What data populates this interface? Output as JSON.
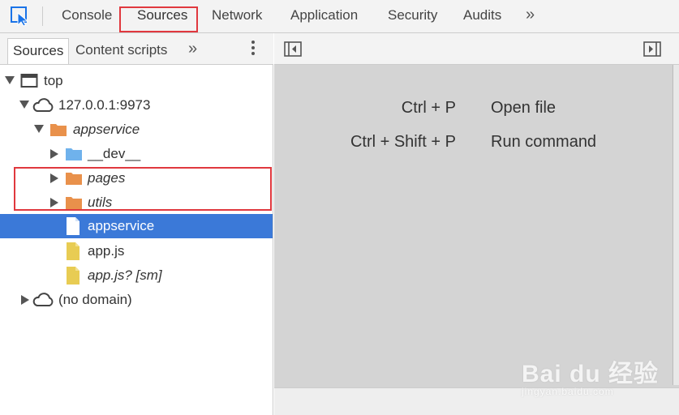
{
  "toolbar": {
    "tabs": [
      "Console",
      "Sources",
      "Network",
      "Application",
      "Security",
      "Audits"
    ],
    "more": "»",
    "active_tab": "Sources"
  },
  "navigator": {
    "subtabs": [
      "Sources",
      "Content scripts"
    ],
    "more": "»",
    "tree": [
      {
        "label": "top",
        "level": 0,
        "expanded": true,
        "type": "frame"
      },
      {
        "label": "127.0.0.1:9973",
        "level": 1,
        "expanded": true,
        "type": "domain"
      },
      {
        "label": "appservice",
        "level": 2,
        "expanded": true,
        "type": "folder-orange"
      },
      {
        "label": "__dev__",
        "level": 3,
        "expanded": false,
        "type": "folder-blue"
      },
      {
        "label": "pages",
        "level": 3,
        "expanded": false,
        "type": "folder-orange"
      },
      {
        "label": "utils",
        "level": 3,
        "expanded": false,
        "type": "folder-orange"
      },
      {
        "label": "appservice",
        "level": 3,
        "type": "file-document",
        "selected": true
      },
      {
        "label": "app.js",
        "level": 3,
        "type": "file-script"
      },
      {
        "label": "app.js? [sm]",
        "level": 3,
        "type": "file-script"
      },
      {
        "label": "(no domain)",
        "level": 1,
        "expanded": false,
        "type": "domain"
      }
    ]
  },
  "editor": {
    "shortcuts": [
      {
        "keys": "Ctrl + P",
        "action": "Open file"
      },
      {
        "keys": "Ctrl + Shift + P",
        "action": "Run command"
      }
    ]
  },
  "watermark": {
    "main": "Bai du 经验",
    "sub": "jingyan.baidu.com"
  },
  "colors": {
    "accent": "#3b79d8",
    "highlight": "#e0383e",
    "folder_orange": "#e9914b",
    "folder_blue": "#6fb2ec",
    "script_yellow": "#e8cc53"
  }
}
